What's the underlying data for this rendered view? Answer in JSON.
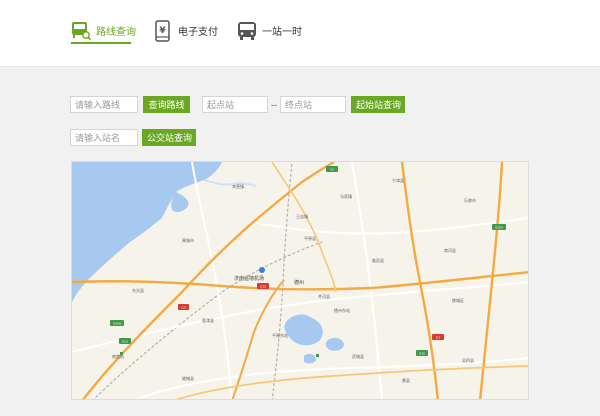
{
  "tabs": [
    {
      "label": "路线查询",
      "icon": "bus-search-icon",
      "active": true
    },
    {
      "label": "电子支付",
      "icon": "yuan-phone-icon",
      "active": false
    },
    {
      "label": "一站一时",
      "icon": "bus-icon",
      "active": false
    }
  ],
  "route_search": {
    "route_placeholder": "请输入路线",
    "route_button": "查询路线",
    "start_placeholder": "起点站",
    "separator": "--",
    "end_placeholder": "终点站",
    "start_end_button": "起始站查询"
  },
  "station_search": {
    "station_placeholder": "请输入站名",
    "station_button": "公交站查询"
  },
  "map": {
    "city_label": "德州",
    "airport_label": "济南遥墙机场",
    "places": [
      "李营镇",
      "王店镇",
      "马家镇",
      "临邑县",
      "平原县",
      "夏津县",
      "齐河县",
      "禹城市",
      "乐陵市",
      "商河县",
      "宁津县",
      "陵城区",
      "德州东站",
      "平原东站",
      "南宫站",
      "武城县",
      "故城县",
      "景县",
      "吴桥县",
      "东光县"
    ],
    "shields": [
      "G3",
      "G20",
      "S1",
      "G35",
      "G2",
      "S12",
      "G308",
      "G205"
    ],
    "colors": {
      "water": "#a7c9f0",
      "land": "#f6f3ea",
      "highway": "#f5a941",
      "road": "#ffffff",
      "rail": "#b0b0b0",
      "green_shield": "#3f9a4a",
      "red_shield": "#d63c2f"
    }
  },
  "colors": {
    "accent": "#6aa823"
  }
}
